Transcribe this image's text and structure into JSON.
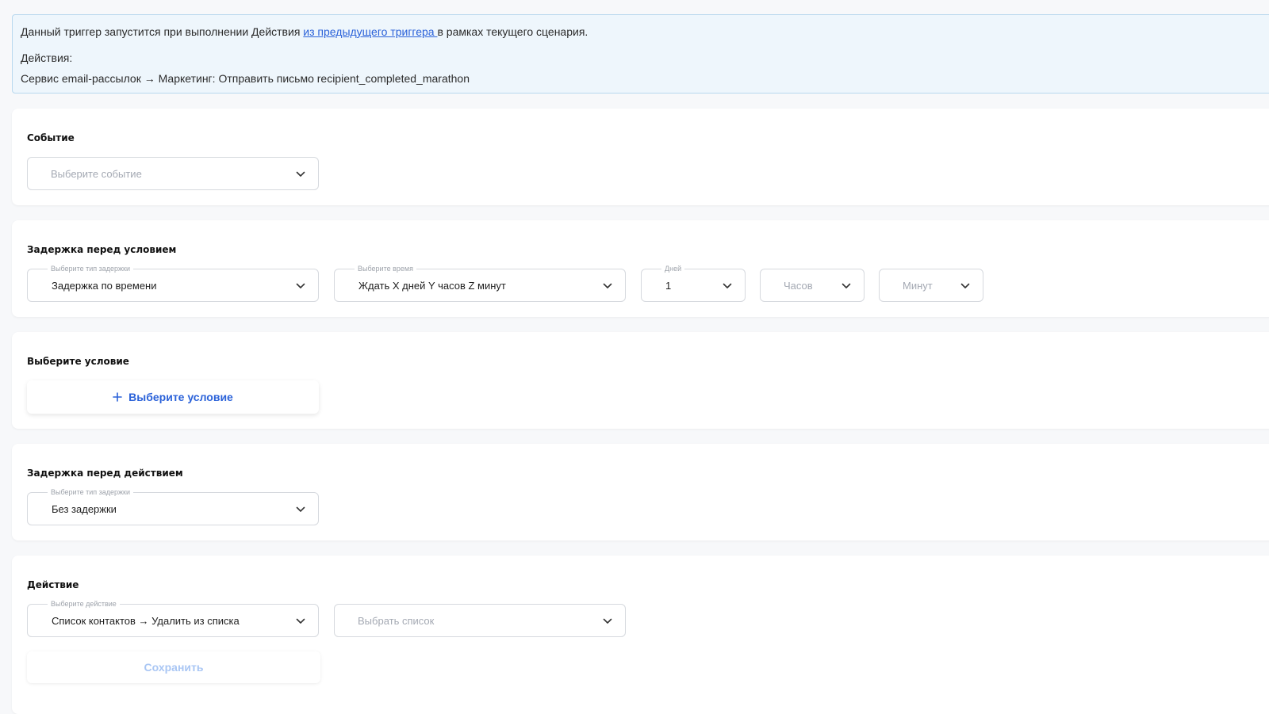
{
  "info": {
    "text_before_link": "Данный триггер запустится при выполнении Действия ",
    "link": "из предыдущего триггера ",
    "text_after_link": "в рамках текущего сценария.",
    "actions_label": "Действия:",
    "actions_value": "Сервис email-рассылок → Маркетинг: Отправить письмо recipient_completed_marathon"
  },
  "event": {
    "title": "Событие",
    "select_placeholder": "Выберите событие"
  },
  "delay_condition": {
    "title": "Задержка перед условием",
    "type_label": "Выберите тип задержки",
    "type_value": "Задержка по времени",
    "time_label": "Выберите время",
    "time_value": "Ждать X дней Y часов Z минут",
    "days_label": "Дней",
    "days_value": "1",
    "hours_placeholder": "Часов",
    "minutes_placeholder": "Минут"
  },
  "condition": {
    "title": "Выберите условие",
    "add_button": "Выберите условие"
  },
  "delay_action": {
    "title": "Задержка перед действием",
    "type_label": "Выберите тип задержки",
    "type_value": "Без задержки"
  },
  "action": {
    "title": "Действие",
    "action_label": "Выберите действие",
    "action_value": "Список контактов → Удалить из списка",
    "list_placeholder": "Выбрать список",
    "save_button": "Сохранить"
  }
}
